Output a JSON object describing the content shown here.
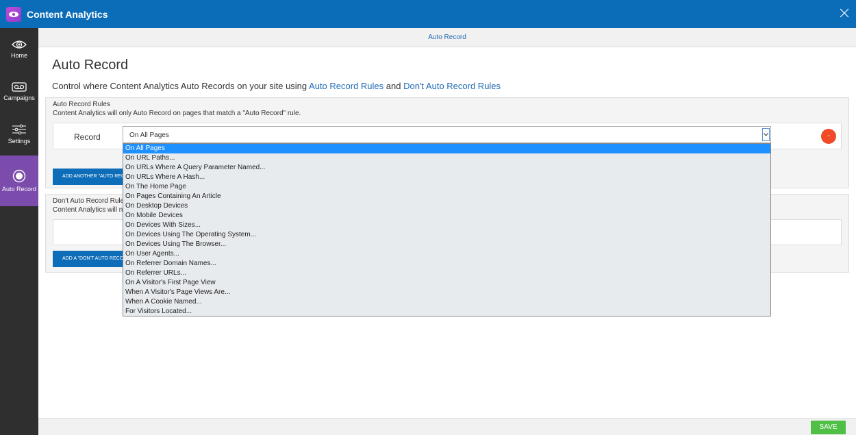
{
  "app": {
    "title": "Content Analytics",
    "brand_color": "#0b6db7"
  },
  "sidebar": {
    "items": [
      {
        "label": "Home",
        "icon": "eye-icon"
      },
      {
        "label": "Campaigns",
        "icon": "cassette-icon"
      },
      {
        "label": "Settings",
        "icon": "sliders-icon"
      },
      {
        "label": "Auto Record",
        "icon": "record-icon",
        "active": true
      }
    ]
  },
  "tabbar": {
    "label": "Auto Record"
  },
  "page": {
    "title": "Auto Record",
    "desc_prefix": "Control where Content Analytics Auto Records on your site using ",
    "link1": "Auto Record Rules",
    "desc_mid": " and ",
    "link2": "Don't Auto Record Rules"
  },
  "auto_rules": {
    "title": "Auto Record Rules",
    "subtitle": "Content Analytics will only Auto Record on pages that match a \"Auto Record\" rule.",
    "row_label": "Record",
    "selected_value": "On All Pages",
    "remove_label": "-",
    "add_button": "ADD ANOTHER \"AUTO RECORD\" RULE"
  },
  "dont_rules": {
    "title": "Don't Auto Record Rules",
    "subtitle": "Content Analytics will not Auto Record on pages that match a \"Don't Auto Record\" rule.",
    "add_button": "ADD A \"DON'T AUTO RECORD\" RULE"
  },
  "dropdown_options": [
    "On All Pages",
    "On URL Paths...",
    "On URLs Where A Query Parameter Named...",
    "On URLs Where A Hash...",
    "On The Home Page",
    "On Pages Containing An Article",
    "On Desktop Devices",
    "On Mobile Devices",
    "On Devices With Sizes...",
    "On Devices Using The Operating System...",
    "On Devices Using The Browser...",
    "On User Agents...",
    "On Referrer Domain Names...",
    "On Referrer URLs...",
    "On A Visitor's First Page View",
    "When A Visitor's Page Views Are...",
    "When A Cookie Named...",
    "For Visitors Located..."
  ],
  "footer": {
    "save_label": "SAVE",
    "save_color": "#4fbf46"
  }
}
